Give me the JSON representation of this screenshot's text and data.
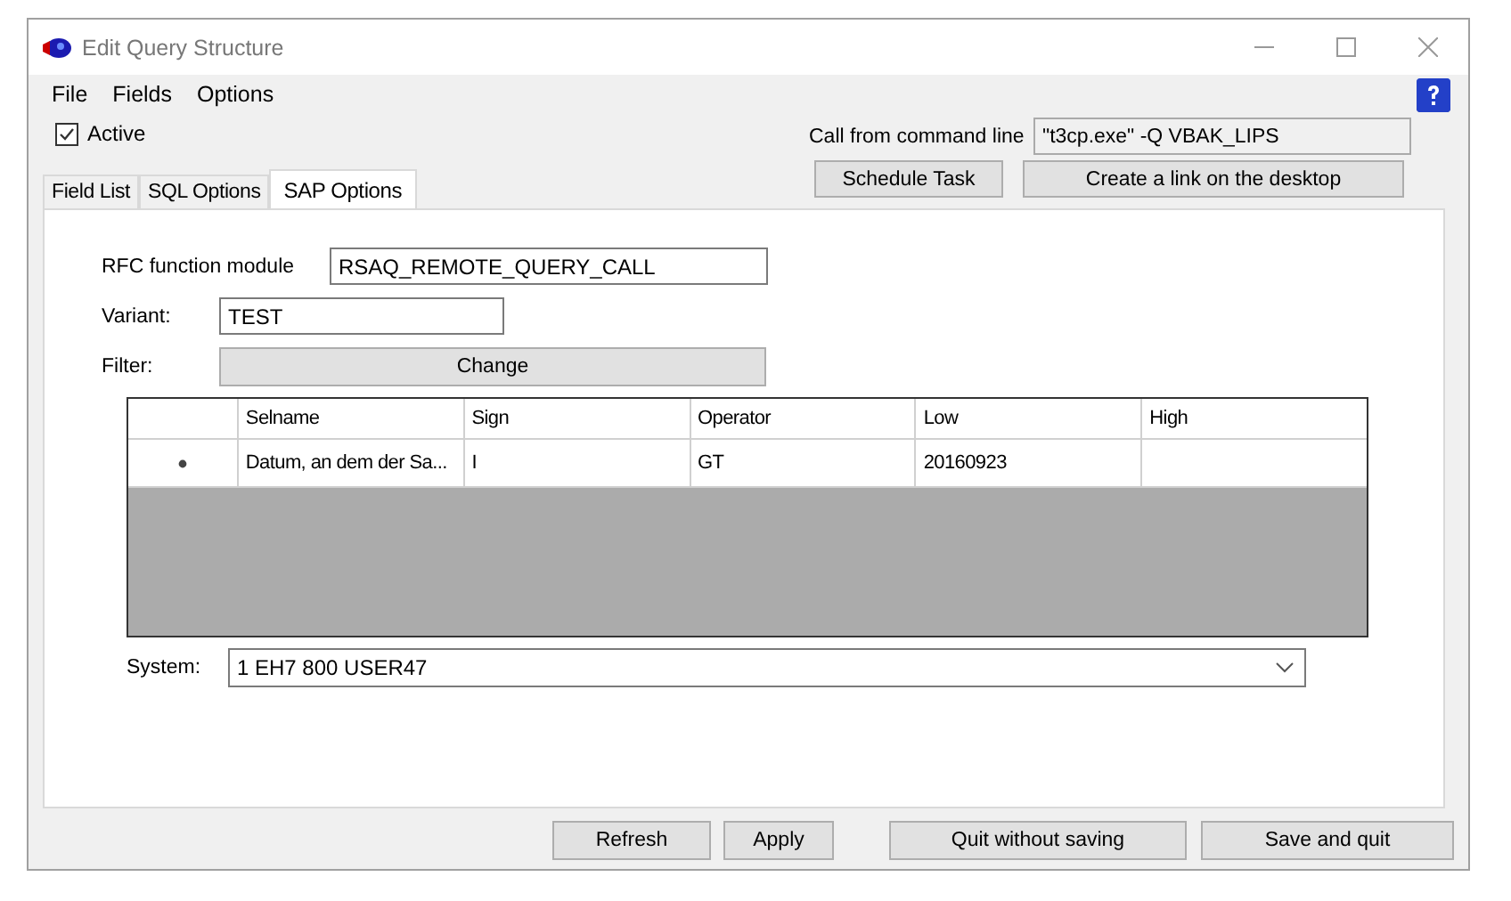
{
  "window": {
    "title": "Edit Query Structure"
  },
  "menu": [
    "File",
    "Fields",
    "Options"
  ],
  "active": {
    "label": "Active",
    "checked": true
  },
  "command_line": {
    "label": "Call from command line",
    "value": "\"t3cp.exe\" -Q VBAK_LIPS"
  },
  "top_buttons": [
    "Schedule Task",
    "Create a link on the desktop"
  ],
  "tabs": [
    {
      "label": "Field List",
      "selected": false
    },
    {
      "label": "SQL Options",
      "selected": false
    },
    {
      "label": "SAP Options",
      "selected": true
    }
  ],
  "rfc_function_module": {
    "label": "RFC function module",
    "value": "RSAQ_REMOTE_QUERY_CALL"
  },
  "variant": {
    "label": "Variant:",
    "value": "TEST"
  },
  "filter": {
    "label": "Filter:",
    "button": "Change"
  },
  "grid": {
    "columns": [
      "Selname",
      "Sign",
      "Operator",
      "Low",
      "High"
    ],
    "rows": [
      {
        "cells": [
          "Datum, an dem der Sa...",
          "I",
          "GT",
          "20160923",
          ""
        ]
      }
    ]
  },
  "system": {
    "label": "System:",
    "value": "1 EH7 800 USER47"
  },
  "bottom_buttons": [
    "Refresh",
    "Apply",
    "Quit without saving",
    "Save and quit"
  ]
}
